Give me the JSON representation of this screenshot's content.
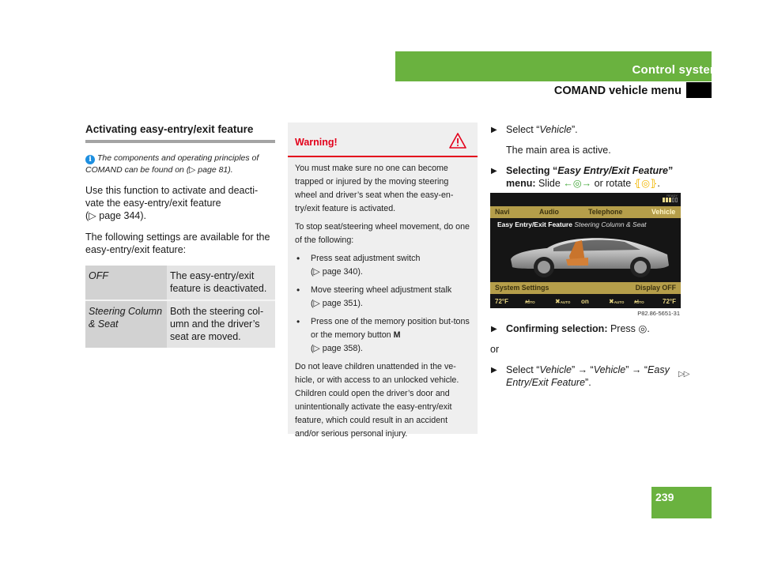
{
  "header": {
    "section": "Control systems",
    "subsection": "COMAND vehicle menu"
  },
  "left": {
    "title": "Activating easy-entry/exit feature",
    "note_icon": "info-icon",
    "note": "The components and operating principles of COMAND can be found on (▷ page 81).",
    "para1_line1": "Use this function to activate and deacti-",
    "para1_line2": "vate the easy-entry/exit feature",
    "para1_line3": "(▷ page 344).",
    "para2": "The following settings are available for the easy-entry/exit feature:",
    "table": [
      {
        "setting": "OFF",
        "description": "The easy-entry/exit feature is deactivated."
      },
      {
        "setting": "Steering Column & Seat",
        "description": "Both the steering col-umn and the driver’s seat are moved."
      }
    ]
  },
  "warning": {
    "title": "Warning!",
    "icon": "warning-triangle-icon",
    "p1": "You must make sure no one can become trapped or injured by the moving steering wheel and driver’s seat when the easy-en-try/exit feature is activated.",
    "p2": "To stop seat/steering wheel movement, do one of the following:",
    "bullets": [
      {
        "text": "Press seat adjustment switch",
        "ref": "(▷ page 340)."
      },
      {
        "text": "Move steering wheel adjustment stalk",
        "ref": "(▷ page 351)."
      },
      {
        "text": "Press one of the memory position but-tons or the memory button ",
        "bold": "M",
        "ref": "(▷ page 358)."
      }
    ],
    "p3": "Do not leave children unattended in the ve-hicle, or with access to an unlocked vehicle. Children could open the driver’s door and unintentionally activate the easy-entry/exit feature, which could result in an accident and/or serious personal injury."
  },
  "right": {
    "step1_prefix": "Select “",
    "step1_item": "Vehicle",
    "step1_suffix": "”.",
    "step1_result": "The main area is active.",
    "step2_bold": "Selecting “",
    "step2_item": "Easy Entry/Exit Feature",
    "step2_bold2": "” menu:",
    "step2_text1": " Slide ",
    "step2_slide_icon": "←◎→",
    "step2_text2": " or rotate ",
    "step2_rotate_icon": "⦃◎⦄",
    "step2_end": ".",
    "step3_bold": "Confirming selection:",
    "step3_text": " Press ",
    "step3_icon": "◎",
    "step3_end": ".",
    "or": "or",
    "step4_a": "Select “",
    "step4_i1": "Vehicle",
    "step4_b": "” → “",
    "step4_i2": "Vehicle",
    "step4_c": "” → “",
    "step4_i3": "Easy Entry/Exit Feature",
    "step4_d": "”.",
    "continue_icon": "▷▷"
  },
  "screen": {
    "ready": "READY",
    "top_menu": [
      "Navi",
      "Audio",
      "Telephone",
      "Vehicle"
    ],
    "title_bold": "Easy Entry/Exit Feature",
    "title_italic": "Steering Column & Seat",
    "bottom_left": "System Settings",
    "bottom_right": "Display OFF",
    "climate": {
      "temp_left": "72°F",
      "auto_left": "AUTO",
      "fan_left": "AUTO",
      "center": "on",
      "fan_right": "AUTO",
      "auto_right": "AUTO",
      "temp_right": "72°F"
    },
    "figure_id": "P82.86-5651-31"
  },
  "footer": {
    "page_number": "239"
  }
}
